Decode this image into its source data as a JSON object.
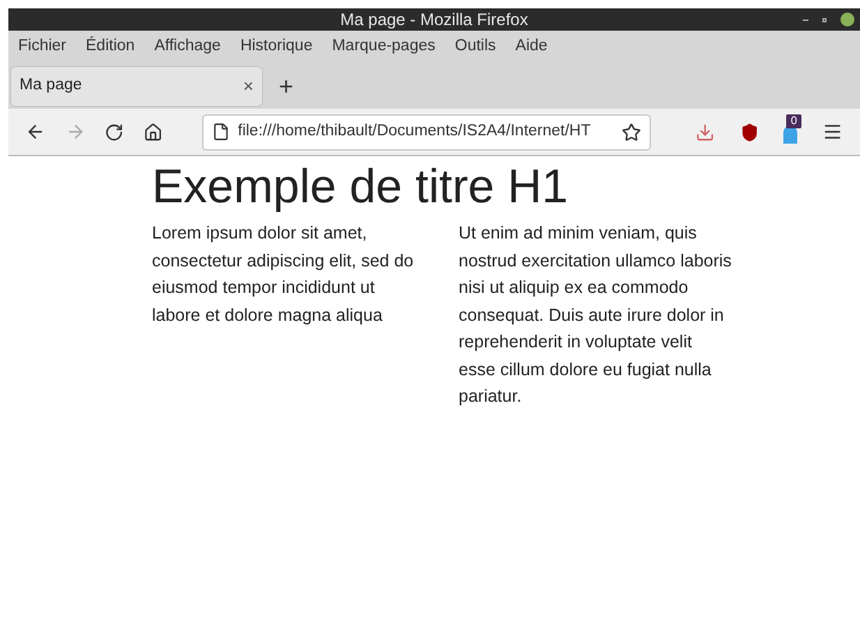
{
  "window": {
    "title": "Ma page - Mozilla Firefox"
  },
  "menu": [
    "Fichier",
    "Édition",
    "Affichage",
    "Historique",
    "Marque-pages",
    "Outils",
    "Aide"
  ],
  "tabs": [
    {
      "label": "Ma page",
      "selected": true,
      "close": "×"
    }
  ],
  "new_tab": "+",
  "address_bar": {
    "url": "file:///home/thibault/Documents/IS2A4/Internet/HT"
  },
  "extension_badge": "0",
  "page": {
    "heading": "Exemple de titre H1",
    "columns": [
      "Lorem ipsum dolor sit amet, consectetur adipiscing elit, sed do eiusmod tempor incididunt ut labore et dolore magna aliqua",
      "Ut enim ad minim veniam, quis nostrud exercitation ullamco laboris nisi ut aliquip ex ea commodo consequat. Duis aute irure dolor in reprehenderit in voluptate velit esse cillum dolore eu fugiat nulla pariatur."
    ]
  }
}
